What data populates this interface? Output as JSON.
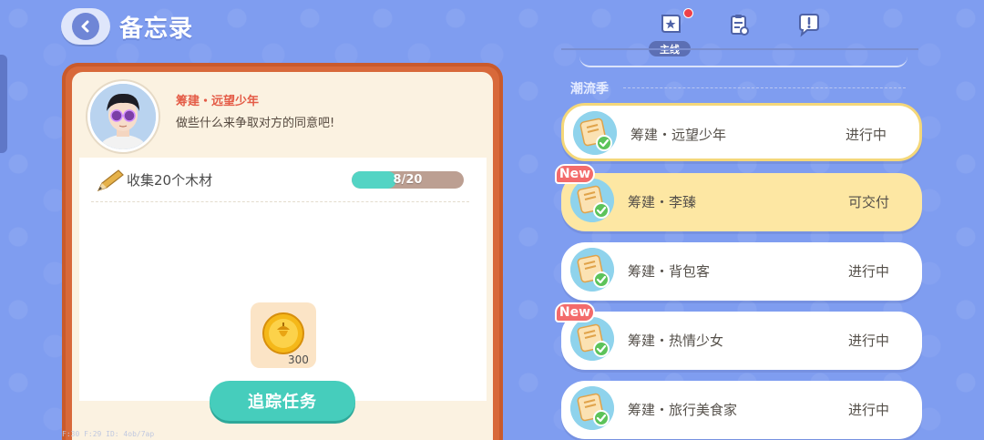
{
  "header": {
    "title": "备忘录",
    "back_icon": "chevron-left-icon"
  },
  "npc": {
    "name": "筹建・远望少年",
    "dialogue": "做些什么来争取对方的同意吧!"
  },
  "task": {
    "description": "收集20个木材",
    "progress_text": "8/20",
    "progress_value": 8,
    "progress_max": 20
  },
  "reward": {
    "icon": "acorn-coin-icon",
    "count": "300"
  },
  "actions": {
    "track_label": "追踪任务"
  },
  "debug_text": "F:30  F:29  ID: 4ob/7ap",
  "tabs": [
    {
      "icon": "main-quest-icon",
      "label": "主线",
      "active": true,
      "has_alert": true
    },
    {
      "icon": "clipboard-icon",
      "label": "",
      "active": false
    },
    {
      "icon": "chat-exclaim-icon",
      "label": "",
      "active": false
    }
  ],
  "quest_list": {
    "section_title": "潮流季",
    "new_label": "New",
    "items": [
      {
        "name": "筹建・远望少年",
        "status": "进行中",
        "state": "selected",
        "is_new": false
      },
      {
        "name": "筹建・李臻",
        "status": "可交付",
        "state": "highlight",
        "is_new": true
      },
      {
        "name": "筹建・背包客",
        "status": "进行中",
        "state": "normal",
        "is_new": false
      },
      {
        "name": "筹建・热情少女",
        "status": "进行中",
        "state": "normal",
        "is_new": true
      },
      {
        "name": "筹建・旅行美食家",
        "status": "进行中",
        "state": "normal",
        "is_new": false
      }
    ]
  },
  "colors": {
    "background": "#7f9df0",
    "card_frame": "#d8693a",
    "accent_teal": "#46cdbc",
    "npc_name": "#e45c47",
    "new_badge": "#f36b6b",
    "highlight": "#fde7a3"
  }
}
